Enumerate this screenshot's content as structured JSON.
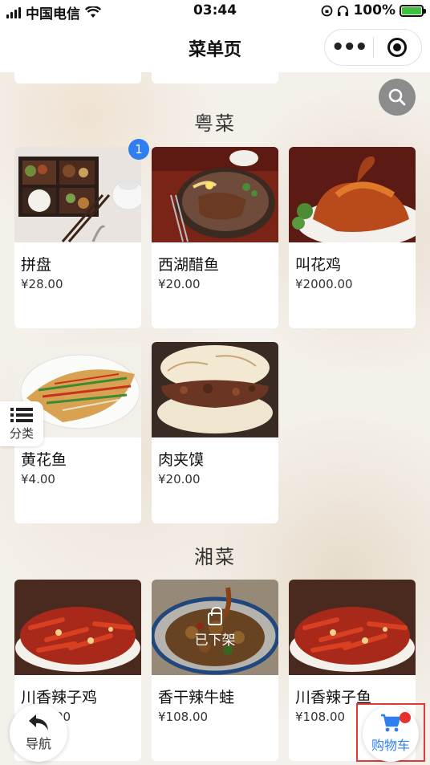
{
  "status_bar": {
    "carrier": "中国电信",
    "time": "03:44",
    "battery": "100%"
  },
  "nav": {
    "title": "菜单页"
  },
  "sections": [
    {
      "title": "粤菜",
      "items": [
        {
          "name": "拼盘",
          "price": "¥28.00",
          "badge": "1",
          "image": "bento-box-photo"
        },
        {
          "name": "西湖醋鱼",
          "price": "¥20.00",
          "image": "steak-plate-photo"
        },
        {
          "name": "叫花鸡",
          "price": "¥2000.00",
          "image": "roast-duck-photo"
        },
        {
          "name": "黄花鱼",
          "price": "¥4.00",
          "image": "steamed-fish-photo"
        },
        {
          "name": "肉夹馍",
          "price": "¥20.00",
          "image": "roujiamo-photo"
        }
      ]
    },
    {
      "title": "湘菜",
      "items": [
        {
          "name": "川香辣子鸡",
          "price": "¥108.00",
          "image": "chili-chicken-photo"
        },
        {
          "name": "香干辣牛蛙",
          "price": "¥108.00",
          "status": "已下架",
          "image": "bullfrog-photo"
        },
        {
          "name": "川香辣子鱼",
          "price": "¥108.00",
          "image": "chili-fish-photo"
        }
      ]
    }
  ],
  "floating": {
    "category_label": "分类",
    "nav_label": "导航",
    "cart_label": "购物车"
  },
  "colors": {
    "accent": "#2f7ff0",
    "alert": "#e53030",
    "highlight_box": "#e03a3a"
  }
}
